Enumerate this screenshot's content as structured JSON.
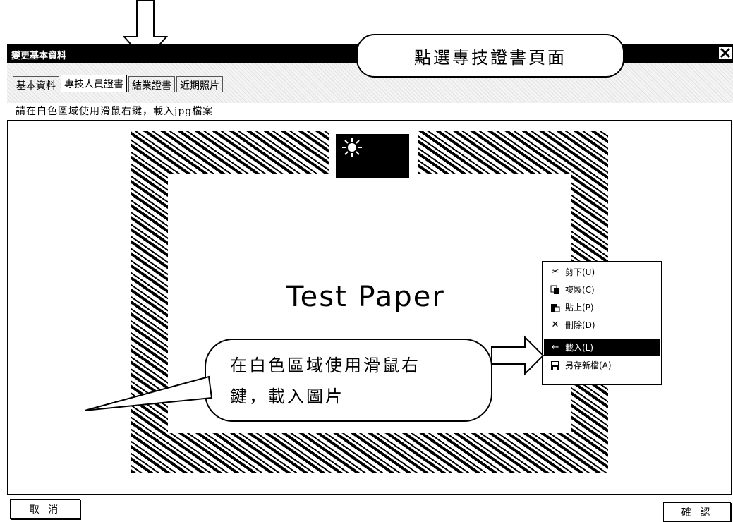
{
  "window": {
    "title": "變更基本資料"
  },
  "callouts": {
    "top": "點選專技證書頁面",
    "bottom_line1": "在白色區域使用滑鼠右",
    "bottom_line2": "鍵，載入圖片"
  },
  "tabs": [
    {
      "label": "基本資料",
      "active": false
    },
    {
      "label": "專技人員證書",
      "active": true
    },
    {
      "label": "結業證書",
      "active": false
    },
    {
      "label": "近期照片",
      "active": false
    }
  ],
  "instruction": "請在白色區域使用滑鼠右鍵，載入jpg檔案",
  "certificate": {
    "text": "Test Paper"
  },
  "context_menu": {
    "items": [
      {
        "label": "剪下(U)",
        "icon": "scissors-icon",
        "highlighted": false
      },
      {
        "label": "複製(C)",
        "icon": "copy-icon",
        "highlighted": false
      },
      {
        "label": "貼上(P)",
        "icon": "paste-icon",
        "highlighted": false
      },
      {
        "label": "刪除(D)",
        "icon": "delete-icon",
        "highlighted": false
      },
      {
        "label": "載入(L)",
        "icon": "load-icon",
        "highlighted": true
      },
      {
        "label": "另存新檔(A)",
        "icon": "save-icon",
        "highlighted": false
      }
    ]
  },
  "buttons": {
    "cancel": "取 消",
    "ok": "確 認"
  }
}
